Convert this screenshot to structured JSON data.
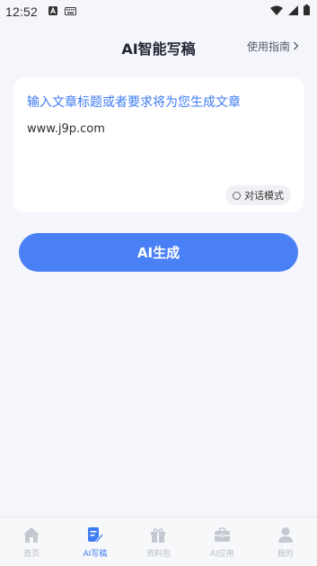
{
  "status_bar": {
    "time": "12:52"
  },
  "header": {
    "title": "AI智能写稿",
    "guide_label": "使用指南"
  },
  "prompt": {
    "placeholder": "输入文章标题或者要求将为您生成文章",
    "value": "www.j9p.com",
    "mode_label": "对话模式"
  },
  "generate_button": {
    "label": "AI生成"
  },
  "tab_bar": {
    "items": [
      {
        "label": "首页",
        "icon": "home-icon",
        "active": false
      },
      {
        "label": "AI写稿",
        "icon": "write-icon",
        "active": true
      },
      {
        "label": "资料包",
        "icon": "gift-icon",
        "active": false
      },
      {
        "label": "AI应用",
        "icon": "briefcase-icon",
        "active": false
      },
      {
        "label": "我的",
        "icon": "user-icon",
        "active": false
      }
    ]
  },
  "colors": {
    "accent": "#4a80f5",
    "placeholder": "#3f7cf1",
    "inactive_tab": "#b8bcc6",
    "background": "#f4f6fb"
  }
}
